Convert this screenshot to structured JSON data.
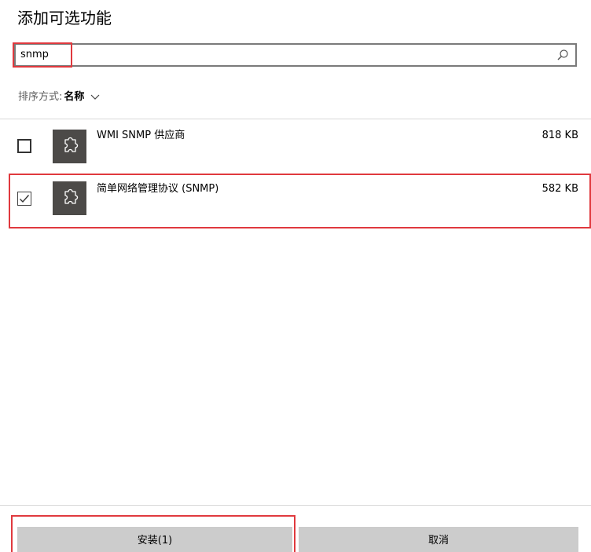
{
  "dialog": {
    "title": "添加可选功能"
  },
  "search": {
    "value": "snmp",
    "placeholder": ""
  },
  "sort": {
    "label": "排序方式:",
    "value": "名称"
  },
  "features": [
    {
      "name": "WMI SNMP 供应商",
      "size": "818 KB",
      "checked": false,
      "icon": "puzzle-piece-icon"
    },
    {
      "name": "简单网络管理协议 (SNMP)",
      "size": "582 KB",
      "checked": true,
      "icon": "puzzle-piece-icon"
    }
  ],
  "buttons": {
    "install": "安装(1)",
    "cancel": "取消"
  },
  "colors": {
    "highlight": "#e0393e",
    "icon_tile": "#4c4a48",
    "button_bg": "#cccccc",
    "search_border": "#7a7a7a"
  }
}
